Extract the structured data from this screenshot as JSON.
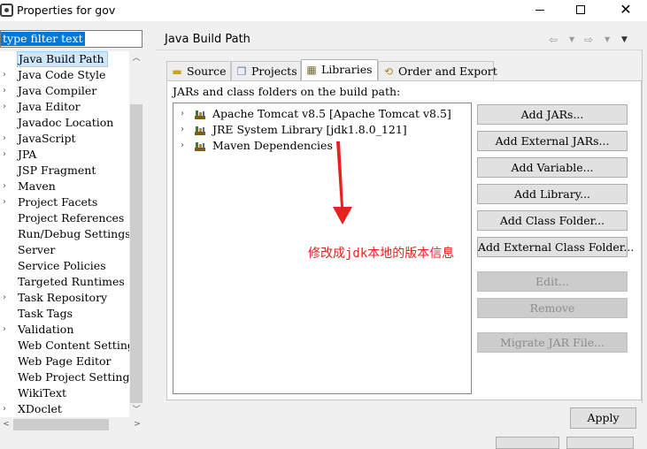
{
  "window": {
    "title": "Properties for gov",
    "minimize_icon": "minimize-icon",
    "maximize_icon": "maximize-icon",
    "close_label": "✕"
  },
  "filter": {
    "value": "type filter text"
  },
  "tree": {
    "items": [
      {
        "label": "Java Build Path",
        "expandable": false,
        "selected": true
      },
      {
        "label": "Java Code Style",
        "expandable": true,
        "selected": false
      },
      {
        "label": "Java Compiler",
        "expandable": true,
        "selected": false
      },
      {
        "label": "Java Editor",
        "expandable": true,
        "selected": false
      },
      {
        "label": "Javadoc Location",
        "expandable": false,
        "selected": false
      },
      {
        "label": "JavaScript",
        "expandable": true,
        "selected": false
      },
      {
        "label": "JPA",
        "expandable": true,
        "selected": false
      },
      {
        "label": "JSP Fragment",
        "expandable": false,
        "selected": false
      },
      {
        "label": "Maven",
        "expandable": true,
        "selected": false
      },
      {
        "label": "Project Facets",
        "expandable": true,
        "selected": false
      },
      {
        "label": "Project References",
        "expandable": false,
        "selected": false
      },
      {
        "label": "Run/Debug Settings",
        "expandable": false,
        "selected": false
      },
      {
        "label": "Server",
        "expandable": false,
        "selected": false
      },
      {
        "label": "Service Policies",
        "expandable": false,
        "selected": false
      },
      {
        "label": "Targeted Runtimes",
        "expandable": false,
        "selected": false
      },
      {
        "label": "Task Repository",
        "expandable": true,
        "selected": false
      },
      {
        "label": "Task Tags",
        "expandable": false,
        "selected": false
      },
      {
        "label": "Validation",
        "expandable": true,
        "selected": false
      },
      {
        "label": "Web Content Settings",
        "expandable": false,
        "selected": false
      },
      {
        "label": "Web Page Editor",
        "expandable": false,
        "selected": false
      },
      {
        "label": "Web Project Settings",
        "expandable": false,
        "selected": false
      },
      {
        "label": "WikiText",
        "expandable": false,
        "selected": false
      },
      {
        "label": "XDoclet",
        "expandable": true,
        "selected": false
      }
    ]
  },
  "page": {
    "title": "Java Build Path"
  },
  "tabs": [
    {
      "label": "Source",
      "icon": "source-folder-icon",
      "active": false
    },
    {
      "label": "Projects",
      "icon": "projects-icon",
      "active": false
    },
    {
      "label": "Libraries",
      "icon": "libraries-icon",
      "active": true
    },
    {
      "label": "Order and Export",
      "icon": "order-export-icon",
      "active": false
    }
  ],
  "libraries": {
    "heading": "JARs and class folders on the build path:",
    "entries": [
      {
        "label": "Apache Tomcat v8.5 [Apache Tomcat v8.5]"
      },
      {
        "label": "JRE System Library [jdk1.8.0_121]"
      },
      {
        "label": "Maven Dependencies"
      }
    ]
  },
  "buttons": [
    {
      "label": "Add JARs...",
      "enabled": true
    },
    {
      "label": "Add External JARs...",
      "enabled": true
    },
    {
      "label": "Add Variable...",
      "enabled": true
    },
    {
      "label": "Add Library...",
      "enabled": true
    },
    {
      "label": "Add Class Folder...",
      "enabled": true
    },
    {
      "label": "Add External Class Folder...",
      "enabled": true
    },
    {
      "label": "Edit...",
      "enabled": false
    },
    {
      "label": "Remove",
      "enabled": false
    },
    {
      "label": "Migrate JAR File...",
      "enabled": false
    }
  ],
  "apply_label": "Apply",
  "annotation": {
    "text": "修改成jdk本地的版本信息",
    "color": "#e8201e"
  },
  "colors": {
    "selection": "#0078d7",
    "tree_selected": "#cce8ff",
    "annotation": "#e8201e"
  }
}
